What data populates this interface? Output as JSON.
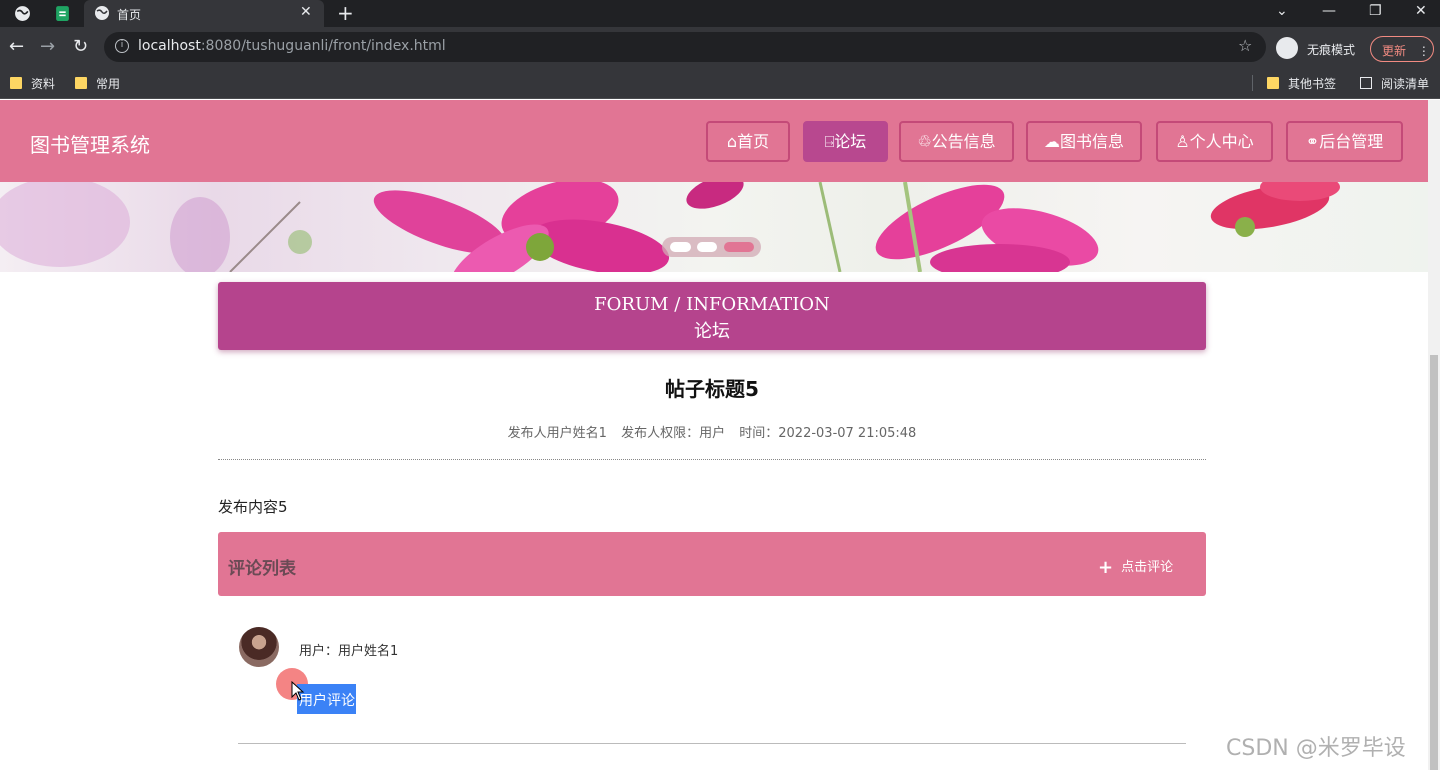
{
  "browser": {
    "tab_title": "首页",
    "url_host": "localhost",
    "url_rest": ":8080/tushuguanli/front/index.html",
    "incognito_label": "无痕模式",
    "update_label": "更新",
    "bookmarks": [
      "资料",
      "常用"
    ],
    "other_bookmarks": "其他书签",
    "reading_list": "阅读清单"
  },
  "site": {
    "title": "图书管理系统",
    "nav": [
      {
        "icon": "home-icon",
        "label": "首页"
      },
      {
        "icon": "forum-icon",
        "label": "论坛"
      },
      {
        "icon": "notice-icon",
        "label": "公告信息"
      },
      {
        "icon": "book-icon",
        "label": "图书信息"
      },
      {
        "icon": "user-icon",
        "label": "个人中心"
      },
      {
        "icon": "link-icon",
        "label": "后台管理"
      }
    ],
    "active_nav": "论坛"
  },
  "section": {
    "title_en": "FORUM / INFORMATION",
    "title_cn": "论坛"
  },
  "post": {
    "title": "帖子标题5",
    "author": "发布人用户姓名1",
    "role": "发布人权限：用户",
    "time": "时间：2022-03-07 21:05:48",
    "content": "发布内容5"
  },
  "comments": {
    "header": "评论列表",
    "add_label": "点击评论",
    "items": [
      {
        "user": "用户：用户姓名1",
        "text": "用户评论"
      }
    ]
  },
  "watermark": "CSDN @米罗毕设",
  "colors": {
    "header_pink": "#e17594",
    "accent_magenta": "#b5448d",
    "browser_dark": "#202124"
  }
}
